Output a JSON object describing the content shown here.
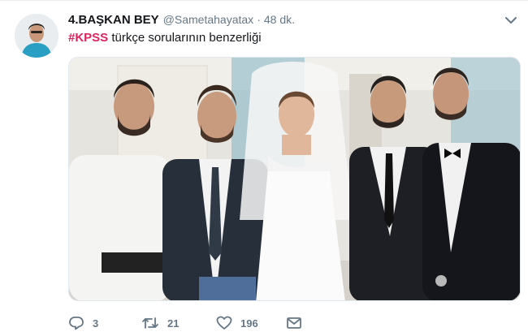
{
  "tweet": {
    "display_name": "4.BAŞKAN BEY",
    "handle": "@Sametahayatax",
    "separator": "·",
    "time": "48 dk.",
    "hashtag": "#KPSS",
    "text": " türkçe sorularının benzerliği",
    "photo_icon": "wedding-photo",
    "avatar_icon": "user-avatar"
  },
  "actions": {
    "reply_count": "3",
    "retweet_count": "21",
    "like_count": "196"
  },
  "colors": {
    "hashtag": "#e0245e",
    "secondary_text": "#657786",
    "primary_text": "#14171a"
  }
}
